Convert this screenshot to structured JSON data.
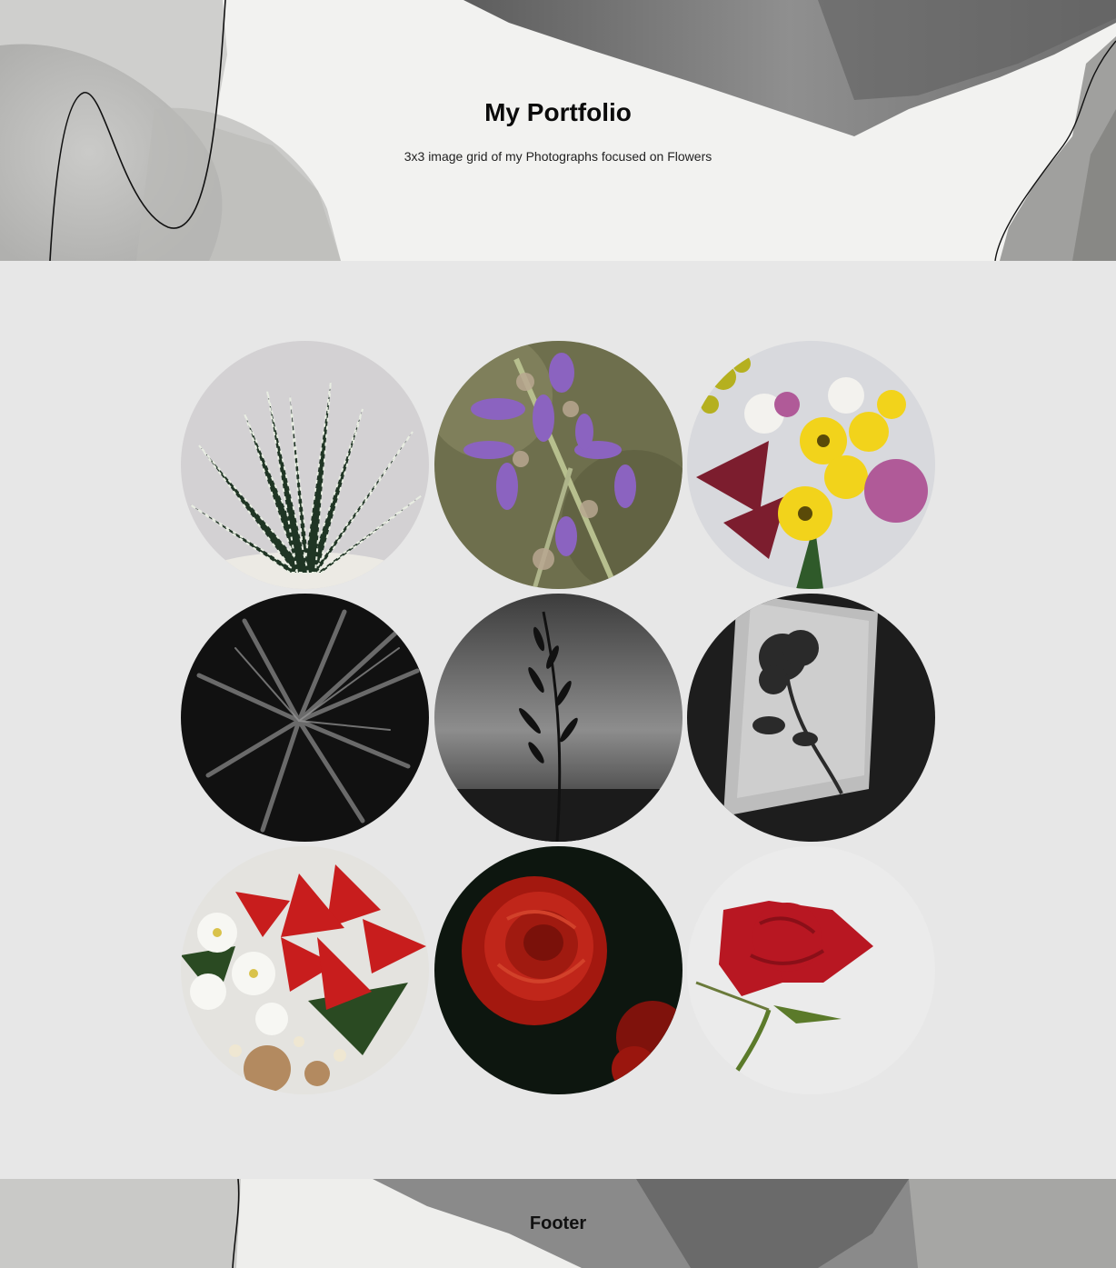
{
  "header": {
    "title": "My Portfolio",
    "subtitle": "3x3 image grid of my Photographs focused on Flowers"
  },
  "gallery": {
    "photos": [
      {
        "subject": "zebra-succulent",
        "palette": [
          "#d8d6d8",
          "#1f3524",
          "#e9ece4"
        ]
      },
      {
        "subject": "purple-sage",
        "palette": [
          "#6d6e4a",
          "#8b63c0",
          "#b7aa92"
        ]
      },
      {
        "subject": "mixed-bouquet",
        "palette": [
          "#d9dade",
          "#f2d31b",
          "#b05a98"
        ]
      },
      {
        "subject": "dark-palm-leaves",
        "palette": [
          "#121212",
          "#3a3a3a",
          "#777777"
        ]
      },
      {
        "subject": "grass-silhouette",
        "palette": [
          "#5a5a5a",
          "#1a1a1a",
          "#9a9a9a"
        ]
      },
      {
        "subject": "rose-shadow",
        "palette": [
          "#1e1e1e",
          "#c8c8c8",
          "#303030"
        ]
      },
      {
        "subject": "poinsettia-arrangement",
        "palette": [
          "#c81d1d",
          "#f4f4f0",
          "#b38a60"
        ]
      },
      {
        "subject": "red-rose-dark",
        "palette": [
          "#0e1a10",
          "#a3180f",
          "#d2301f"
        ]
      },
      {
        "subject": "red-rose-white",
        "palette": [
          "#ececec",
          "#b81722",
          "#5b7a2a"
        ]
      }
    ]
  },
  "footer": {
    "label": "Footer"
  },
  "colors": {
    "page_background": "#e7e7e7",
    "header_paper": "#f2f2f0",
    "watercolor_gray": "#8a8a8a",
    "text": "#111111"
  }
}
